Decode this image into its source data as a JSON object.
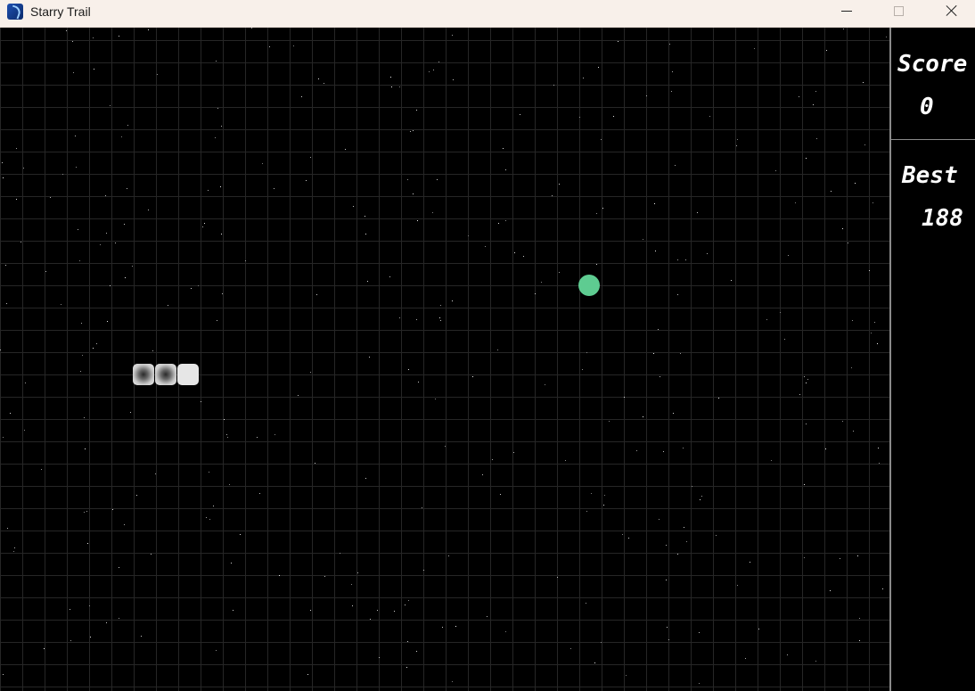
{
  "window": {
    "title": "Starry Trail",
    "app_icon": "starry-trail-app-icon",
    "controls": {
      "minimize_icon": "minimize-icon",
      "maximize_icon": "maximize-icon",
      "close_icon": "close-icon"
    }
  },
  "scoreboard": {
    "score_label": "Score",
    "score_value": "0",
    "best_label": "Best",
    "best_value": "188"
  },
  "game": {
    "snake_length": 3,
    "snake_color": "#e6e6e6",
    "food_color": "#5ecc91",
    "grid_color": "#262626",
    "background_color": "#000000"
  }
}
